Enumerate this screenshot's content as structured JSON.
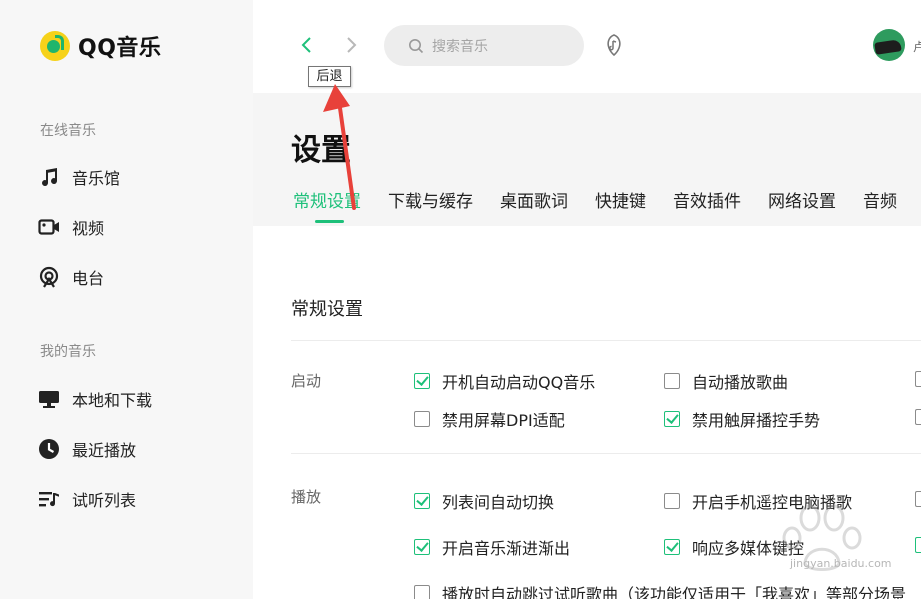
{
  "app": {
    "name": "QQ音乐"
  },
  "sidebar": {
    "online_title": "在线音乐",
    "online_items": [
      {
        "label": "音乐馆",
        "icon": "music-note-icon"
      },
      {
        "label": "视频",
        "icon": "video-icon"
      },
      {
        "label": "电台",
        "icon": "radio-icon"
      }
    ],
    "my_title": "我的音乐",
    "my_items": [
      {
        "label": "本地和下载",
        "icon": "monitor-icon"
      },
      {
        "label": "最近播放",
        "icon": "clock-icon"
      },
      {
        "label": "试听列表",
        "icon": "playlist-icon"
      }
    ]
  },
  "topbar": {
    "search_placeholder": "搜索音乐",
    "back_tooltip": "后退",
    "user_initial": "卢"
  },
  "settings": {
    "title": "设置",
    "tabs": [
      "常规设置",
      "下载与缓存",
      "桌面歌词",
      "快捷键",
      "音效插件",
      "网络设置",
      "音频"
    ],
    "active_tab": 0,
    "section_title": "常规设置",
    "groups": [
      {
        "label": "启动",
        "options": [
          {
            "label": "开机自动启动QQ音乐",
            "checked": true
          },
          {
            "label": "自动播放歌曲",
            "checked": false
          },
          {
            "label": "禁用屏幕DPI适配",
            "checked": false
          },
          {
            "label": "禁用触屏播控手势",
            "checked": true
          }
        ]
      },
      {
        "label": "播放",
        "options": [
          {
            "label": "列表间自动切换",
            "checked": true
          },
          {
            "label": "开启手机遥控电脑播歌",
            "checked": false
          },
          {
            "label": "开启音乐渐进渐出",
            "checked": true
          },
          {
            "label": "响应多媒体键控",
            "checked": true
          },
          {
            "label": "播放时自动跳过试听歌曲（该功能仅适用于「我喜欢」等部分场景",
            "checked": false
          }
        ]
      }
    ]
  },
  "watermark": {
    "text": "jingyan.baidu.com"
  },
  "colors": {
    "accent": "#1ec07a",
    "annotation": "#e8413a"
  }
}
